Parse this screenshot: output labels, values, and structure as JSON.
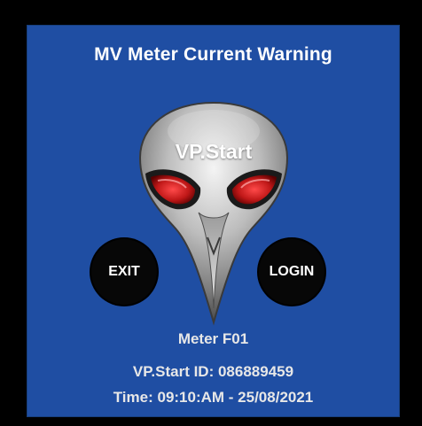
{
  "dialog": {
    "title": "MV Meter Current Warning",
    "logo_text": "VP.Start",
    "logo_icon": "alien-mask-icon"
  },
  "buttons": {
    "exit_label": "EXIT",
    "login_label": "LOGIN"
  },
  "info": {
    "meter": "Meter F01",
    "vpstart_id": "VP.Start ID: 086889459",
    "time": "Time: 09:10:AM - 25/08/2021"
  },
  "colors": {
    "panel_background": "#1f4ea3",
    "outer_background": "#000000",
    "button_background": "#070707",
    "eye_color": "#c01818",
    "text_primary": "#ffffff",
    "text_secondary": "#e7e7e7"
  }
}
